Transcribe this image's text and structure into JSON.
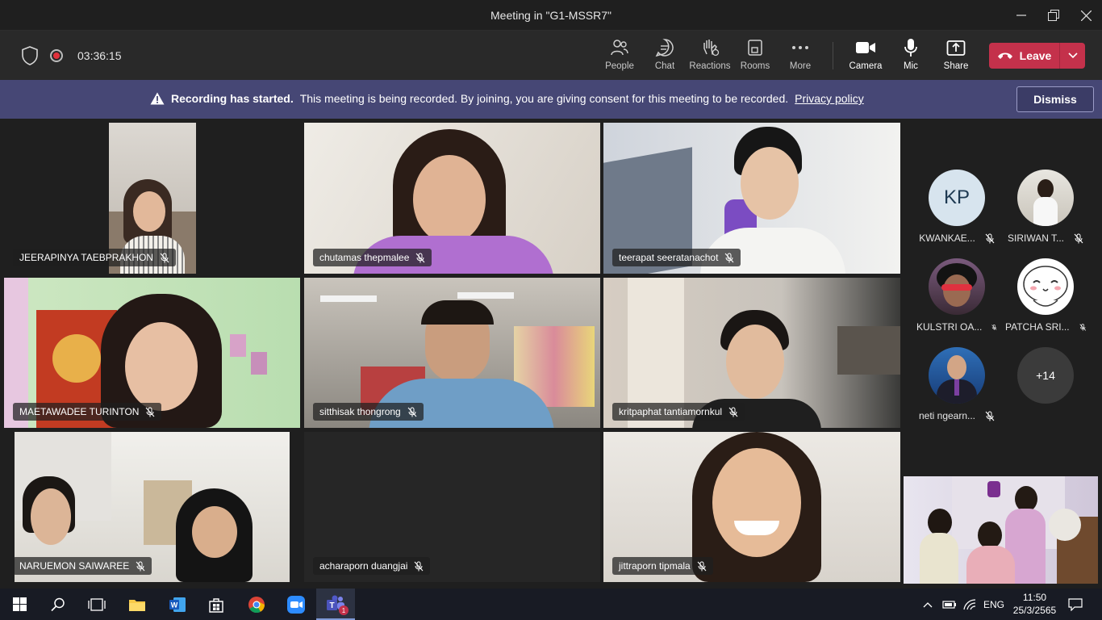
{
  "window": {
    "title": "Meeting in \"G1-MSSR7\""
  },
  "toolbar": {
    "timer": "03:36:15",
    "buttons": [
      {
        "label": "People",
        "icon": "people-icon"
      },
      {
        "label": "Chat",
        "icon": "chat-icon"
      },
      {
        "label": "Reactions",
        "icon": "reactions-icon"
      },
      {
        "label": "Rooms",
        "icon": "rooms-icon"
      },
      {
        "label": "More",
        "icon": "more-icon"
      }
    ],
    "media": [
      {
        "label": "Camera",
        "icon": "camera-icon"
      },
      {
        "label": "Mic",
        "icon": "mic-icon"
      },
      {
        "label": "Share",
        "icon": "share-icon"
      }
    ],
    "leave_label": "Leave"
  },
  "banner": {
    "heading": "Recording has started.",
    "text": "This meeting is being recorded. By joining, you are giving consent for this meeting to be recorded.",
    "link": "Privacy policy",
    "dismiss_label": "Dismiss"
  },
  "participants": [
    {
      "name": "JEERAPINYA TAEBPRAKHON"
    },
    {
      "name": "chutamas thepmalee"
    },
    {
      "name": "teerapat seeratanachot"
    },
    {
      "name": "MAETAWADEE TURINTON"
    },
    {
      "name": "sitthisak thongrong"
    },
    {
      "name": "kritpaphat tantiamornkul"
    },
    {
      "name": "NARUEMON SAIWAREE"
    },
    {
      "name": "acharaporn duangjai"
    },
    {
      "name": "jittraporn tipmala"
    }
  ],
  "side_participants": [
    {
      "name": "KWANKAE...",
      "initials": "KP"
    },
    {
      "name": "SIRIWAN T..."
    },
    {
      "name": "KULSTRI OA..."
    },
    {
      "name": "PATCHA SRI..."
    },
    {
      "name": "neti ngearn..."
    }
  ],
  "overflow_count": "+14",
  "taskbar": {
    "language": "ENG",
    "time": "11:50",
    "date": "25/3/2565",
    "teams_badge": "1"
  }
}
